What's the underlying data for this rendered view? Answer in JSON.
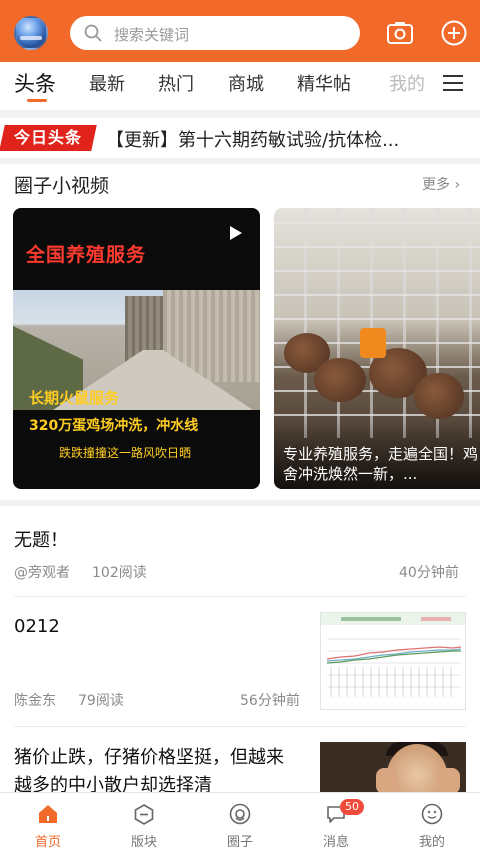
{
  "header": {
    "search_placeholder": "搜索关键词"
  },
  "tabs": [
    "头条",
    "最新",
    "热门",
    "商城",
    "精华帖",
    "我的"
  ],
  "headline": {
    "badge": "今日头条",
    "text": "【更新】第十六期药敏试验/抗体检..."
  },
  "video_section": {
    "title": "圈子小视频",
    "more": "更多",
    "videos": [
      {
        "overlay_title": "全国养殖服务",
        "overlay_sub1": "长期火鼠服务",
        "overlay_sub2": "320万蛋鸡场冲洗，冲水线",
        "overlay_sub3": "跌跌撞撞这一路风吹日晒"
      },
      {
        "caption": "专业养殖服务，走遍全国！鸡舍冲洗焕然一新，..."
      }
    ]
  },
  "articles": [
    {
      "title": "无题！",
      "author": "@旁观者",
      "reads": "102阅读",
      "time": "40分钟前"
    },
    {
      "title": "0212",
      "author": "陈金东",
      "reads": "79阅读",
      "time": "56分钟前"
    },
    {
      "title": "猪价止跌，仔猪价格坚挺，但越来越多的中小散户却选择清"
    }
  ],
  "bottom_nav": [
    {
      "label": "首页",
      "icon": "home-icon",
      "active": true
    },
    {
      "label": "版块",
      "icon": "section-icon",
      "active": false
    },
    {
      "label": "圈子",
      "icon": "circle-icon",
      "active": false
    },
    {
      "label": "消息",
      "icon": "message-icon",
      "active": false,
      "badge": "50"
    },
    {
      "label": "我的",
      "icon": "profile-icon",
      "active": false
    }
  ],
  "colors": {
    "brand": "#f26a2a",
    "headline_badge": "#e0241b"
  }
}
